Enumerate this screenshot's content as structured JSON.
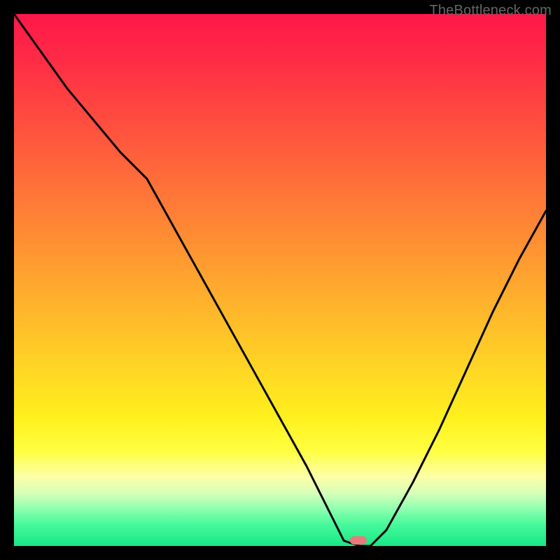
{
  "watermark": "TheBottleneck.com",
  "marker": {
    "x_pct": 64.8,
    "y_pct": 99.0
  },
  "chart_data": {
    "type": "line",
    "title": "",
    "xlabel": "",
    "ylabel": "",
    "xlim": [
      0,
      100
    ],
    "ylim": [
      0,
      100
    ],
    "series": [
      {
        "name": "bottleneck-curve",
        "x": [
          0,
          5,
          10,
          15,
          20,
          25,
          30,
          35,
          40,
          45,
          50,
          55,
          60,
          62,
          65,
          67,
          70,
          75,
          80,
          85,
          90,
          95,
          100
        ],
        "y": [
          100,
          93,
          86,
          80,
          74,
          69,
          60,
          51,
          42,
          33,
          24,
          15,
          5,
          1,
          0,
          0,
          3,
          12,
          22,
          33,
          44,
          54,
          63
        ]
      }
    ],
    "gradient_stops": [
      {
        "pos": 0,
        "color": "#ff1848"
      },
      {
        "pos": 8,
        "color": "#ff2a46"
      },
      {
        "pos": 18,
        "color": "#ff4740"
      },
      {
        "pos": 30,
        "color": "#ff6a3a"
      },
      {
        "pos": 42,
        "color": "#ff8d33"
      },
      {
        "pos": 54,
        "color": "#ffb12c"
      },
      {
        "pos": 66,
        "color": "#ffd425"
      },
      {
        "pos": 76,
        "color": "#fff01e"
      },
      {
        "pos": 82,
        "color": "#ffff40"
      },
      {
        "pos": 87,
        "color": "#fdffa8"
      },
      {
        "pos": 90,
        "color": "#d8ffb8"
      },
      {
        "pos": 93,
        "color": "#8fffb0"
      },
      {
        "pos": 96,
        "color": "#46f99a"
      },
      {
        "pos": 100,
        "color": "#17e886"
      }
    ],
    "optimal_point": {
      "x": 64.8,
      "y": 0,
      "color": "#e77a7a"
    }
  }
}
